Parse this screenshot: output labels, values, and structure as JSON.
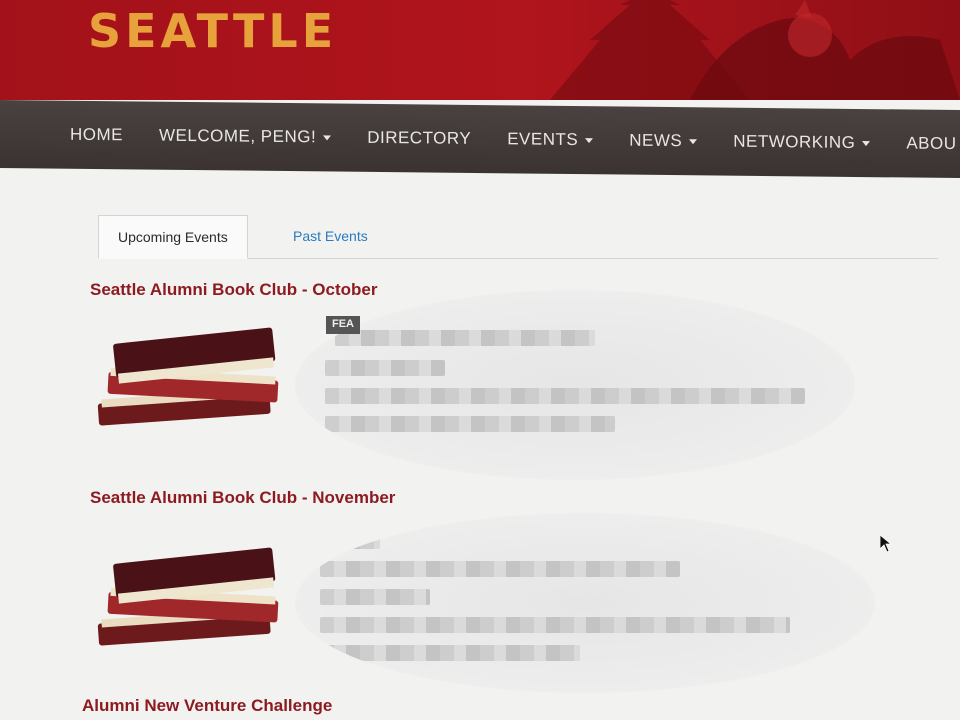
{
  "header": {
    "site_title": "SEATTLE",
    "brand_color": "#a3121a",
    "title_color": "#e8a23c"
  },
  "nav": {
    "items": [
      {
        "label": "HOME",
        "has_dropdown": false
      },
      {
        "label": "WELCOME, PENG!",
        "has_dropdown": true
      },
      {
        "label": "DIRECTORY",
        "has_dropdown": false
      },
      {
        "label": "EVENTS",
        "has_dropdown": true
      },
      {
        "label": "NEWS",
        "has_dropdown": true
      },
      {
        "label": "NETWORKING",
        "has_dropdown": true
      },
      {
        "label": "ABOU",
        "has_dropdown": false
      }
    ]
  },
  "tabs": {
    "upcoming": "Upcoming Events",
    "past": "Past Events"
  },
  "events": [
    {
      "title": "Seattle Alumni Book Club - October",
      "badge": "FEA",
      "thumb_icon": "books-icon"
    },
    {
      "title": "Seattle Alumni Book Club - November",
      "thumb_icon": "books-icon"
    },
    {
      "title": "Alumni New Venture Challenge"
    }
  ]
}
